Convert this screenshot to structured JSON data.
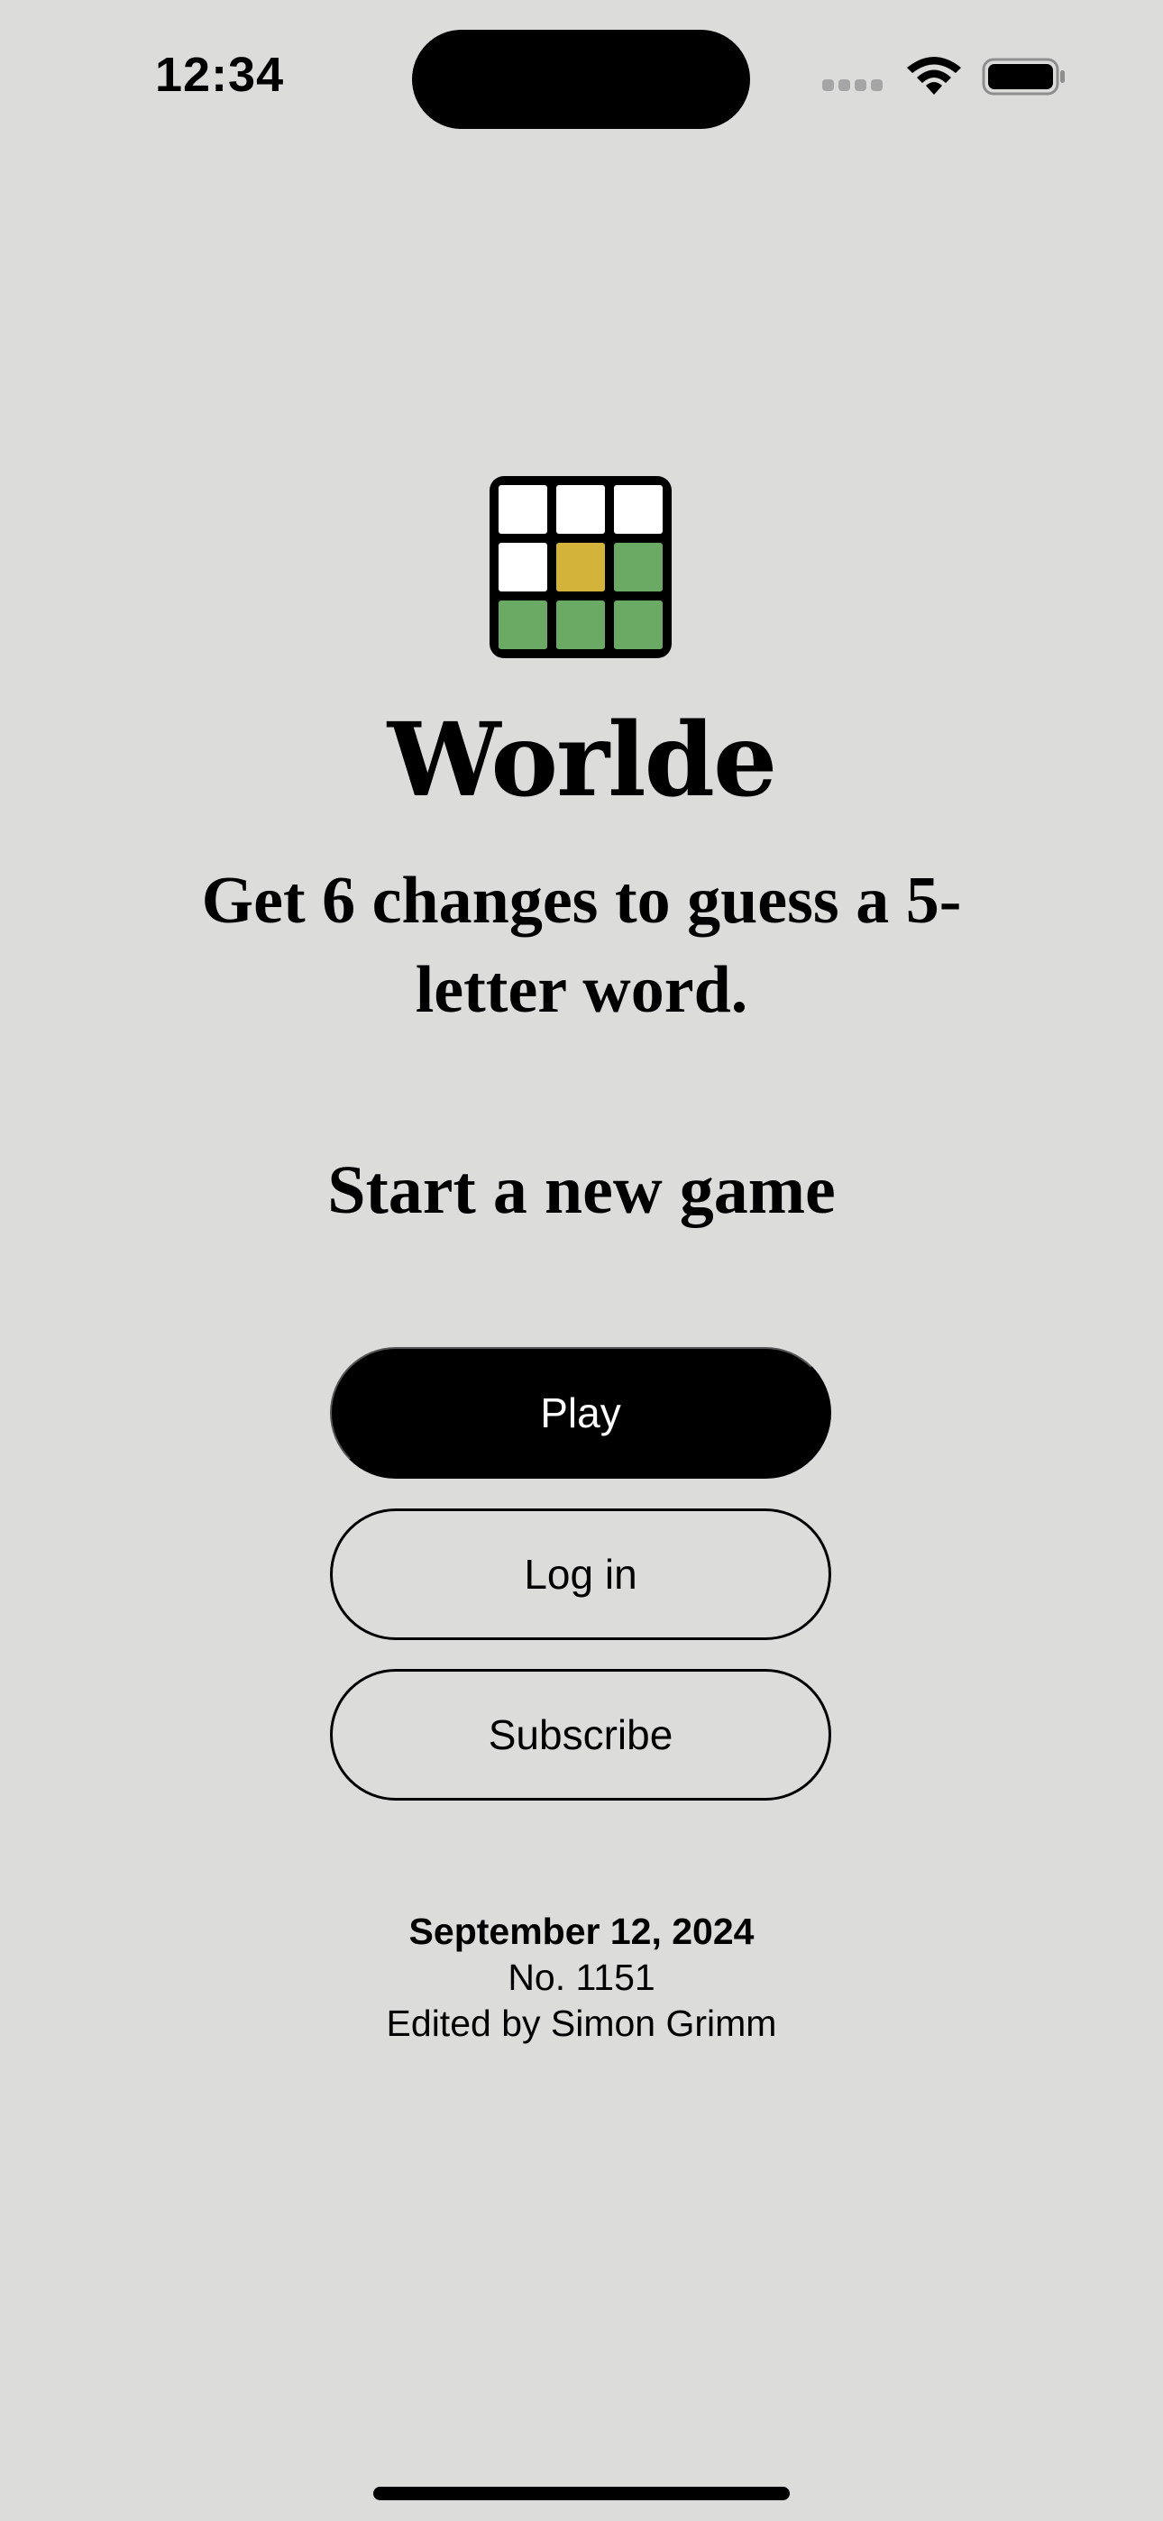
{
  "status_bar": {
    "time": "12:34",
    "icons": [
      "cellular-signal-icon",
      "wifi-icon",
      "battery-icon"
    ]
  },
  "logo": {
    "icon": "wordle-grid-logo-icon",
    "tiles": [
      [
        "#ffffff",
        "#ffffff",
        "#ffffff"
      ],
      [
        "#ffffff",
        "#d4b33a",
        "#6aaa64"
      ],
      [
        "#6aaa64",
        "#6aaa64",
        "#6aaa64"
      ]
    ]
  },
  "hero": {
    "title": "Worlde",
    "subtitle": "Get 6 changes to guess a 5-letter word."
  },
  "section": {
    "heading": "Start a new game"
  },
  "actions": {
    "play_label": "Play",
    "login_label": "Log in",
    "subscribe_label": "Subscribe"
  },
  "puzzle_info": {
    "date": "September 12, 2024",
    "number": "No. 1151",
    "editor": "Edited by Simon Grimm"
  },
  "colors": {
    "background": "#dcdcdb",
    "present": "#d4b33a",
    "correct": "#6aaa64",
    "primary_button": "#000000"
  }
}
